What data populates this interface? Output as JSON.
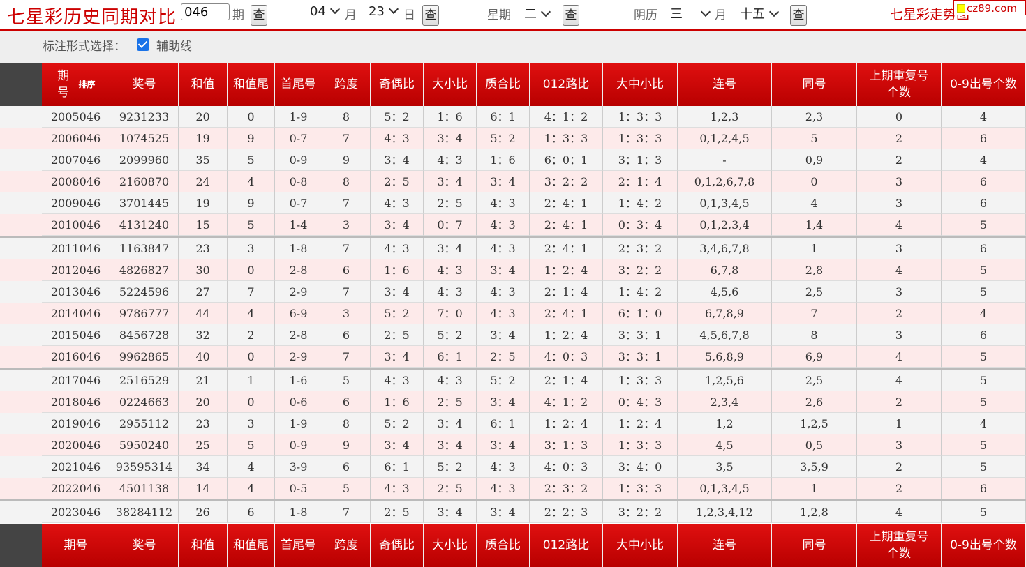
{
  "header": {
    "title": "七星彩历史同期对比",
    "issue_value": "046",
    "issue_suffix": "期",
    "query_label": "查",
    "month_value": "04",
    "month_suffix": "月",
    "day_value": "23",
    "day_suffix": "日",
    "weekday_label": "星期",
    "weekday_value": "二",
    "lunar_label": "阴历",
    "lunar_month_value": "三",
    "lunar_month_suffix": "月",
    "lunar_day_value": "十五",
    "trend_link": "七星彩走势图",
    "watermark": "cz89.com"
  },
  "options": {
    "label": "标注形式选择：",
    "guide_label": "辅助线",
    "guide_checked": true
  },
  "table": {
    "columns": [
      "期号",
      "奖号",
      "和值",
      "和值尾",
      "首尾号",
      "跨度",
      "奇偶比",
      "大小比",
      "质合比",
      "012路比",
      "大中小比",
      "连号",
      "同号",
      "上期重复号个数",
      "0-9出号个数"
    ],
    "sort_label": "排序",
    "rows": [
      [
        "2005046",
        "9231233",
        "20",
        "0",
        "1-9",
        "8",
        "5：2",
        "1：6",
        "6：1",
        "4：1：2",
        "1：3：3",
        "1,2,3",
        "2,3",
        "0",
        "4"
      ],
      [
        "2006046",
        "1074525",
        "19",
        "9",
        "0-7",
        "7",
        "4：3",
        "3：4",
        "5：2",
        "1：3：3",
        "1：3：3",
        "0,1,2,4,5",
        "5",
        "2",
        "6"
      ],
      [
        "2007046",
        "2099960",
        "35",
        "5",
        "0-9",
        "9",
        "3：4",
        "4：3",
        "1：6",
        "6：0：1",
        "3：1：3",
        "-",
        "0,9",
        "2",
        "4"
      ],
      [
        "2008046",
        "2160870",
        "24",
        "4",
        "0-8",
        "8",
        "2：5",
        "3：4",
        "3：4",
        "3：2：2",
        "2：1：4",
        "0,1,2,6,7,8",
        "0",
        "3",
        "6"
      ],
      [
        "2009046",
        "3701445",
        "19",
        "9",
        "0-7",
        "7",
        "4：3",
        "2：5",
        "4：3",
        "2：4：1",
        "1：4：2",
        "0,1,3,4,5",
        "4",
        "3",
        "6"
      ],
      [
        "2010046",
        "4131240",
        "15",
        "5",
        "1-4",
        "3",
        "3：4",
        "0：7",
        "4：3",
        "2：4：1",
        "0：3：4",
        "0,1,2,3,4",
        "1,4",
        "4",
        "5"
      ],
      [
        "2011046",
        "1163847",
        "23",
        "3",
        "1-8",
        "7",
        "4：3",
        "3：4",
        "4：3",
        "2：4：1",
        "2：3：2",
        "3,4,6,7,8",
        "1",
        "3",
        "6"
      ],
      [
        "2012046",
        "4826827",
        "30",
        "0",
        "2-8",
        "6",
        "1：6",
        "4：3",
        "3：4",
        "1：2：4",
        "3：2：2",
        "6,7,8",
        "2,8",
        "4",
        "5"
      ],
      [
        "2013046",
        "5224596",
        "27",
        "7",
        "2-9",
        "7",
        "3：4",
        "4：3",
        "4：3",
        "2：1：4",
        "1：4：2",
        "4,5,6",
        "2,5",
        "3",
        "5"
      ],
      [
        "2014046",
        "9786777",
        "44",
        "4",
        "6-9",
        "3",
        "5：2",
        "7：0",
        "4：3",
        "2：4：1",
        "6：1：0",
        "6,7,8,9",
        "7",
        "2",
        "4"
      ],
      [
        "2015046",
        "8456728",
        "32",
        "2",
        "2-8",
        "6",
        "2：5",
        "5：2",
        "3：4",
        "1：2：4",
        "3：3：1",
        "4,5,6,7,8",
        "8",
        "3",
        "6"
      ],
      [
        "2016046",
        "9962865",
        "40",
        "0",
        "2-9",
        "7",
        "3：4",
        "6：1",
        "2：5",
        "4：0：3",
        "3：3：1",
        "5,6,8,9",
        "6,9",
        "4",
        "5"
      ],
      [
        "2017046",
        "2516529",
        "21",
        "1",
        "1-6",
        "5",
        "4：3",
        "4：3",
        "5：2",
        "2：1：4",
        "1：3：3",
        "1,2,5,6",
        "2,5",
        "4",
        "5"
      ],
      [
        "2018046",
        "0224663",
        "20",
        "0",
        "0-6",
        "6",
        "1：6",
        "2：5",
        "3：4",
        "4：1：2",
        "0：4：3",
        "2,3,4",
        "2,6",
        "2",
        "5"
      ],
      [
        "2019046",
        "2955112",
        "23",
        "3",
        "1-9",
        "8",
        "5：2",
        "3：4",
        "6：1",
        "1：2：4",
        "1：2：4",
        "1,2",
        "1,2,5",
        "1",
        "4"
      ],
      [
        "2020046",
        "5950240",
        "25",
        "5",
        "0-9",
        "9",
        "3：4",
        "3：4",
        "3：4",
        "3：1：3",
        "1：3：3",
        "4,5",
        "0,5",
        "3",
        "5"
      ],
      [
        "2021046",
        "93595314",
        "34",
        "4",
        "3-9",
        "6",
        "6：1",
        "5：2",
        "4：3",
        "4：0：3",
        "3：4：0",
        "3,5",
        "3,5,9",
        "2",
        "5"
      ],
      [
        "2022046",
        "4501138",
        "14",
        "4",
        "0-5",
        "5",
        "4：3",
        "2：5",
        "4：3",
        "2：3：2",
        "1：3：3",
        "0,1,3,4,5",
        "1",
        "2",
        "6"
      ],
      [
        "2023046",
        "38284112",
        "26",
        "6",
        "1-8",
        "7",
        "2：5",
        "3：4",
        "3：4",
        "2：2：3",
        "3：2：2",
        "1,2,3,4,12",
        "1,2,8",
        "4",
        "5"
      ]
    ]
  },
  "colors": {
    "accent": "#cc0000",
    "row_odd": "#f3f3f3",
    "row_even": "#fdeaea"
  }
}
